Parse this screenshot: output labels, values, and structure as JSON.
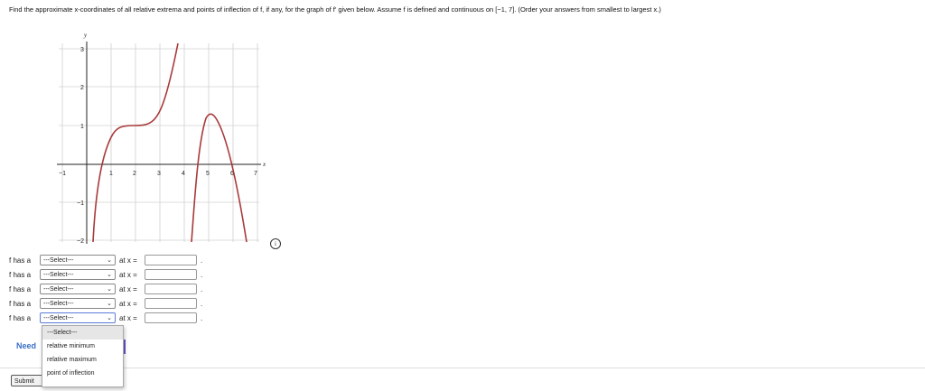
{
  "question": {
    "text": "Find the approximate x-coordinates of all relative extrema and points of inflection of f, if any, for the graph of f′ given below. Assume f is defined and continuous on [−1, 7]. (Order your answers from smallest to largest x.)"
  },
  "graph": {
    "axis_x_label": "x",
    "axis_y_label": "y",
    "x_tick_labels": [
      "−1",
      "1",
      "2",
      "3",
      "4",
      "5",
      "6",
      "7"
    ],
    "y_tick_labels": [
      "3",
      "2",
      "1",
      "−1",
      "−2"
    ],
    "curve_color": "#a83a3a",
    "grid_color": "#cccccc"
  },
  "info_icon": "info-icon",
  "answer_rows": [
    {
      "prefix": "f has a",
      "select_value": "---Select---",
      "at_label": "at x =",
      "answer": "",
      "suffix": "."
    },
    {
      "prefix": "f has a",
      "select_value": "---Select---",
      "at_label": "at x =",
      "answer": "",
      "suffix": "."
    },
    {
      "prefix": "f has a",
      "select_value": "---Select---",
      "at_label": "at x =",
      "answer": "",
      "suffix": "."
    },
    {
      "prefix": "f has a",
      "select_value": "---Select---",
      "at_label": "at x =",
      "answer": "",
      "suffix": "."
    },
    {
      "prefix": "f has a",
      "select_value": "---Select---",
      "at_label": "at x =",
      "answer": "",
      "suffix": "."
    }
  ],
  "dropdown": {
    "options": [
      "---Select---",
      "relative minimum",
      "relative maximum",
      "point of inflection"
    ]
  },
  "footer": {
    "need_help": "Need",
    "submit_label": "Submit"
  }
}
